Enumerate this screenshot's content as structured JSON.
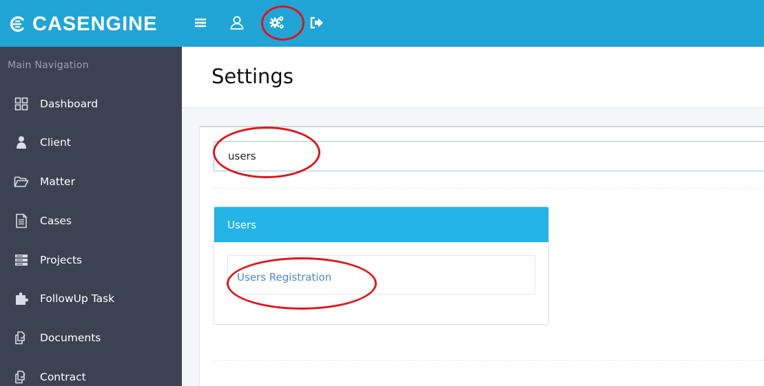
{
  "app": {
    "brand": "CASENGINE"
  },
  "topbar": {
    "icons": [
      "menu-icon",
      "user-icon",
      "gears-icon",
      "sign-out-icon"
    ]
  },
  "sidebar": {
    "header": "Main Navigation",
    "items": [
      {
        "label": "Dashboard",
        "icon": "dashboard-grid-icon"
      },
      {
        "label": "Client",
        "icon": "user-silhouette-icon"
      },
      {
        "label": "Matter",
        "icon": "folder-open-icon"
      },
      {
        "label": "Cases",
        "icon": "document-icon"
      },
      {
        "label": "Projects",
        "icon": "server-stack-icon"
      },
      {
        "label": "FollowUp Task",
        "icon": "puzzle-icon"
      },
      {
        "label": "Documents",
        "icon": "copy-files-icon"
      },
      {
        "label": "Contract",
        "icon": "copy-files-icon"
      }
    ]
  },
  "main": {
    "title": "Settings",
    "search": {
      "value": "users"
    },
    "card": {
      "title": "Users",
      "link": "Users Registration"
    }
  },
  "colors": {
    "topbar": "#21a5d6",
    "sidebar": "#3c4252",
    "card_header": "#24b4e5",
    "link": "#4a86d0",
    "annotation": "#e0141c"
  }
}
